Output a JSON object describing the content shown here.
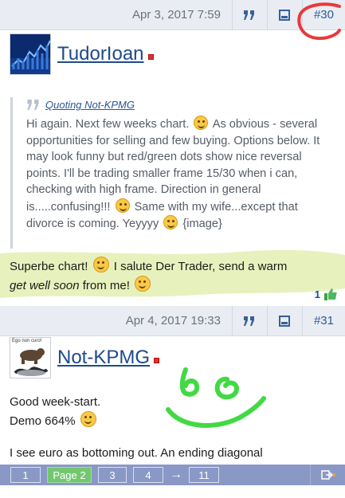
{
  "post1": {
    "date": "Apr 3, 2017 7:59",
    "number": "#30",
    "author": "TudorIoan",
    "quote": {
      "label": "Quoting Not-KPMG",
      "part1": "Hi again. Next few weeks chart.",
      "part2": "As obvious - several opportunities for selling and few buying. Options below. It may look funny but red/green dots show nice reversal points. I'll be trading smaller frame 15/30 when i can, checking with high frame. Direction in general is.....confusing!!!",
      "part3": "Same with my wife...except that divorce is coming. Yeyyyy",
      "part4": "{image}"
    },
    "body": {
      "part1": "Superbe chart!",
      "part2": "I salute Der Trader, send a warm",
      "italic": "get well soon",
      "part3": "from me!"
    },
    "likes": "1"
  },
  "post2": {
    "date": "Apr 4, 2017 19:33",
    "number": "#31",
    "author": "Not-KPMG",
    "avatar_caption": "Ego non curo!",
    "body": {
      "line1": "Good week-start.",
      "line2": "Demo 664%",
      "line3": "I see euro as bottoming out. An ending diagonal"
    }
  },
  "pagination": {
    "pages": [
      "1",
      "Page 2",
      "3",
      "4"
    ],
    "arrow": "→",
    "last": "11"
  },
  "icons": {
    "quote": "quote-icon",
    "multiquote": "multiquote-icon",
    "like": "thumbs-up-icon",
    "online": "online-status-icon",
    "jump": "jump-icon"
  },
  "colors": {
    "header_bg": "#e9ecf2",
    "link": "#1d4b8a",
    "pager_bg": "#8a98c6",
    "current_page": "#73c86f",
    "highlight": "#e4efb6",
    "annotation_red": "#e8393b",
    "annotation_green": "#42d943"
  }
}
